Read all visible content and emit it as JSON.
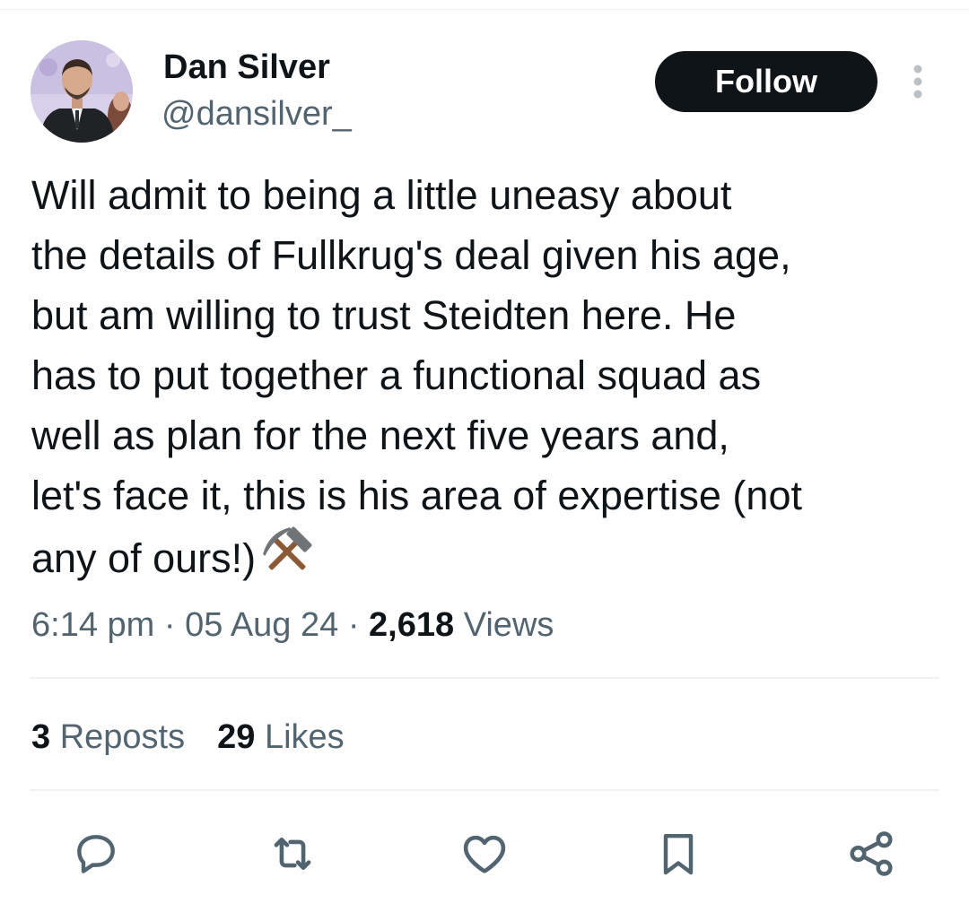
{
  "author": {
    "display_name": "Dan Silver",
    "handle": "@dansilver_"
  },
  "follow_label": "Follow",
  "tweet": {
    "text": "Will admit to being a little uneasy about\nthe details of Fullkrug's deal given his age,\nbut am willing to trust Steidten here. He\nhas to put together a functional squad as\nwell as plan for the next five years and,\nlet's face it, this is his area of expertise (not\nany of ours!)",
    "emoji": "hammer-and-pick-icon"
  },
  "meta": {
    "time": "6:14 pm",
    "sep1": "·",
    "date": "05 Aug 24",
    "sep2": "·",
    "views_count": "2,618",
    "views_label": "Views"
  },
  "stats": {
    "reposts_count": "3",
    "reposts_label": "Reposts",
    "likes_count": "29",
    "likes_label": "Likes"
  },
  "actions": [
    "reply-icon",
    "repost-icon",
    "like-icon",
    "bookmark-icon",
    "share-icon"
  ],
  "colors": {
    "text_primary": "#0f1419",
    "text_secondary": "#536471",
    "divider": "#eff3f4",
    "follow_bg": "#0f1419",
    "follow_text": "#ffffff"
  }
}
